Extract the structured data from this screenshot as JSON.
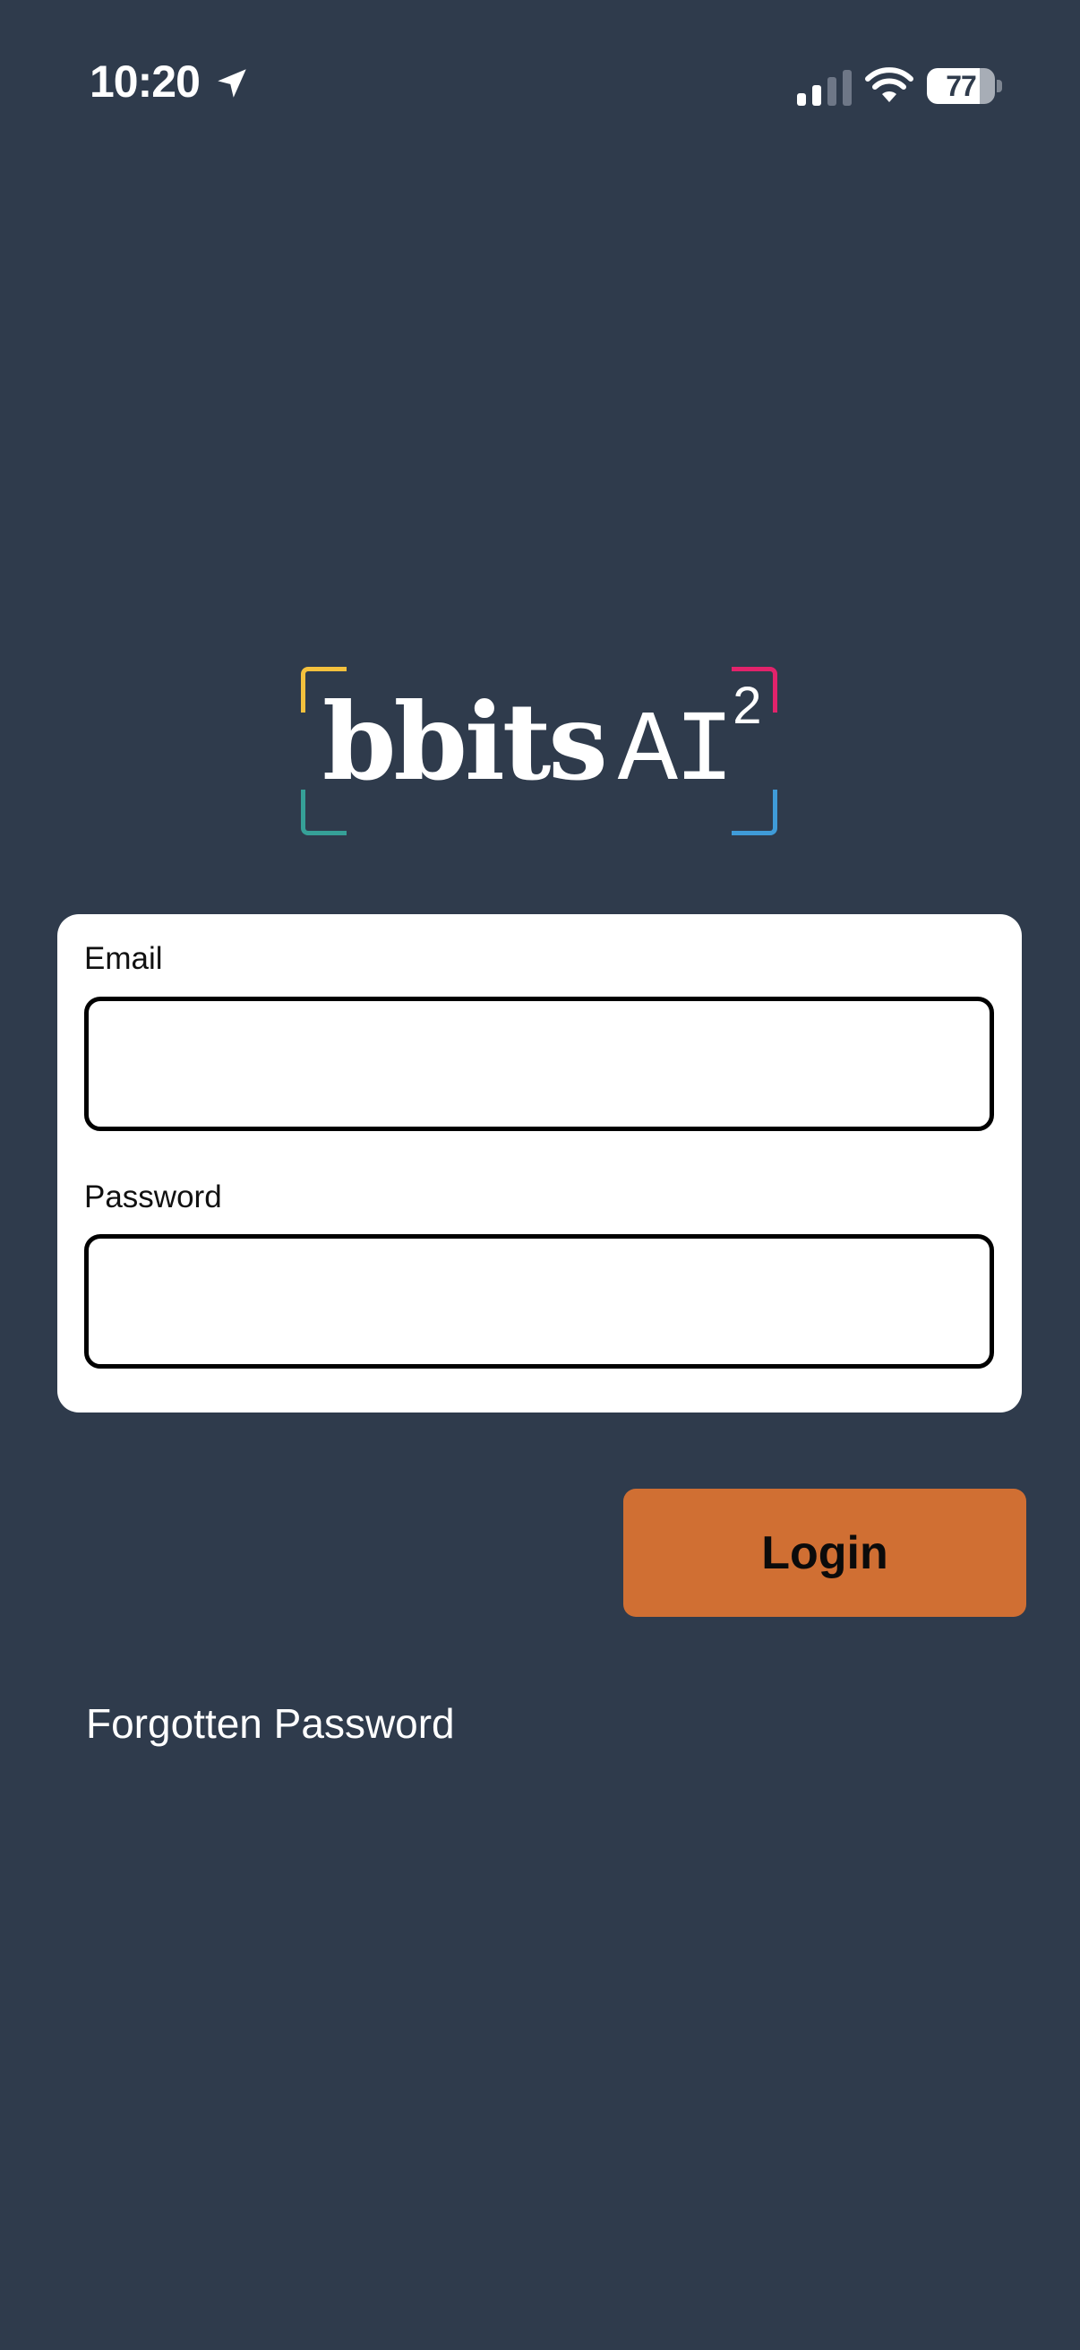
{
  "status_bar": {
    "time": "10:20",
    "battery_level": "77",
    "battery_fraction": 0.77,
    "icons": [
      "location-arrow-icon",
      "cellular-signal-icon",
      "wifi-icon",
      "battery-icon"
    ]
  },
  "logo": {
    "word": "bbits",
    "suffix": "AI",
    "superscript": "2",
    "colors": {
      "top_left": "#f4c13d",
      "top_right": "#e2236b",
      "bottom_left": "#36a097",
      "bottom_right": "#3f9bd8"
    }
  },
  "form": {
    "email_label": "Email",
    "email_value": "",
    "password_label": "Password",
    "password_value": ""
  },
  "actions": {
    "login_label": "Login",
    "forgot_label": "Forgotten Password"
  },
  "colors": {
    "background": "#2f3b4c",
    "accent": "#d06f33",
    "card": "#ffffff"
  }
}
